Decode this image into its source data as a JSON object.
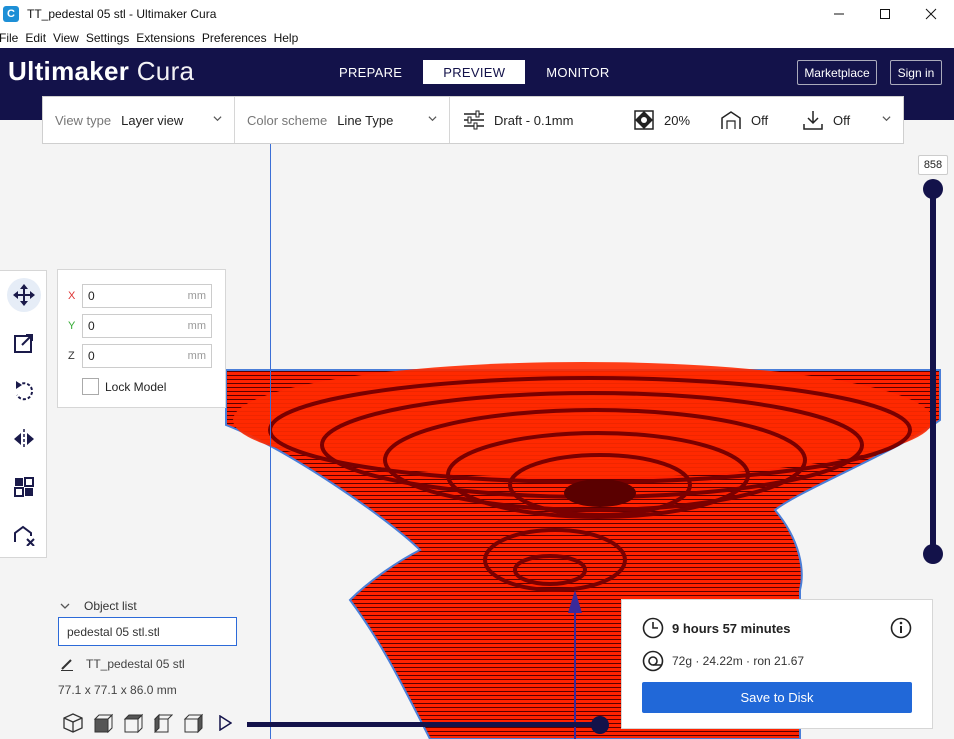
{
  "window": {
    "title": "TT_pedestal 05  stl - Ultimaker Cura",
    "controls": [
      "minimize",
      "maximize",
      "close"
    ]
  },
  "menu": [
    "File",
    "Edit",
    "View",
    "Settings",
    "Extensions",
    "Preferences",
    "Help"
  ],
  "header": {
    "logo_bold": "Ultimaker",
    "logo_light": "Cura",
    "tabs": [
      {
        "label": "PREPARE",
        "active": false
      },
      {
        "label": "PREVIEW",
        "active": true
      },
      {
        "label": "MONITOR",
        "active": false
      }
    ],
    "marketplace_label": "Marketplace",
    "signin_label": "Sign in"
  },
  "settings_bar": {
    "view_type_label": "View type",
    "view_type_value": "Layer view",
    "color_scheme_label": "Color scheme",
    "color_scheme_value": "Line Type",
    "profile": "Draft - 0.1mm",
    "infill": "20%",
    "support": "Off",
    "adhesion": "Off"
  },
  "move_panel": {
    "x_label": "X",
    "x_value": "0",
    "x_unit": "mm",
    "y_label": "Y",
    "y_value": "0",
    "y_unit": "mm",
    "z_label": "Z",
    "z_value": "0",
    "z_unit": "mm",
    "lock_label": "Lock Model",
    "lock_checked": false
  },
  "object_list": {
    "header": "Object list",
    "selected_item": "pedestal 05  stl.stl",
    "object_name": "TT_pedestal 05  stl",
    "dimensions": "77.1 x 77.1 x 86.0 mm"
  },
  "layer_slider": {
    "current_layer": "858"
  },
  "output": {
    "print_time": "9 hours 57 minutes",
    "material": "72g · 24.22m · ron 21.67",
    "save_label": "Save to Disk"
  },
  "colors": {
    "header_bg": "#13124a",
    "accent_blue": "#2168d8",
    "model_red": "#ff1a00",
    "axis_blue": "#3b6fd6"
  }
}
